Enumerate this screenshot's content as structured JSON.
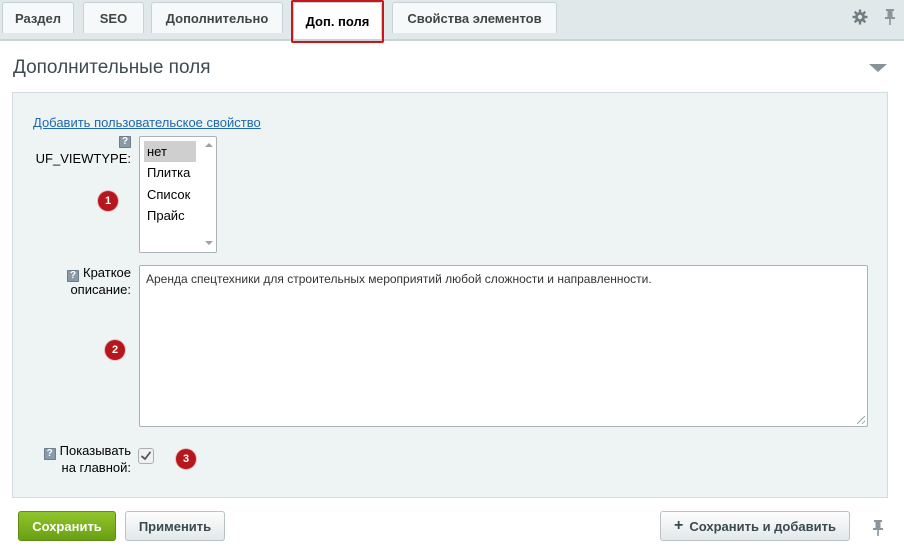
{
  "tabs": [
    {
      "label": "Раздел"
    },
    {
      "label": "SEO"
    },
    {
      "label": "Дополнительно"
    },
    {
      "label": "Доп. поля"
    },
    {
      "label": "Свойства элементов"
    }
  ],
  "active_tab": "Доп. поля",
  "toolbar_icons": [
    "gear-icon",
    "pin-icon"
  ],
  "section": {
    "title": "Дополнительные поля"
  },
  "add_property_link": "Добавить пользовательское свойство",
  "fields": {
    "viewtype": {
      "label": "UF_VIEWTYPE:",
      "options": [
        "нет",
        "Плитка",
        "Список",
        "Прайс"
      ],
      "selected": "нет"
    },
    "short_description": {
      "label_line1": "Краткое",
      "label_line2": "описание:",
      "value": "Аренда спецтехники для строительных мероприятий любой сложности и направленности."
    },
    "show_on_main": {
      "label_line1": "Показывать",
      "label_line2": "на главной:",
      "checked": true
    }
  },
  "help_icon_glyph": "?",
  "markers": [
    "1",
    "2",
    "3"
  ],
  "buttons": {
    "save": "Сохранить",
    "apply": "Применить",
    "save_and_add": "Сохранить и добавить"
  },
  "colors": {
    "marker_red": "#b5171c",
    "save_green": "#7ab51d",
    "link_blue": "#2067b0",
    "active_tab_outline": "#c8161d"
  }
}
